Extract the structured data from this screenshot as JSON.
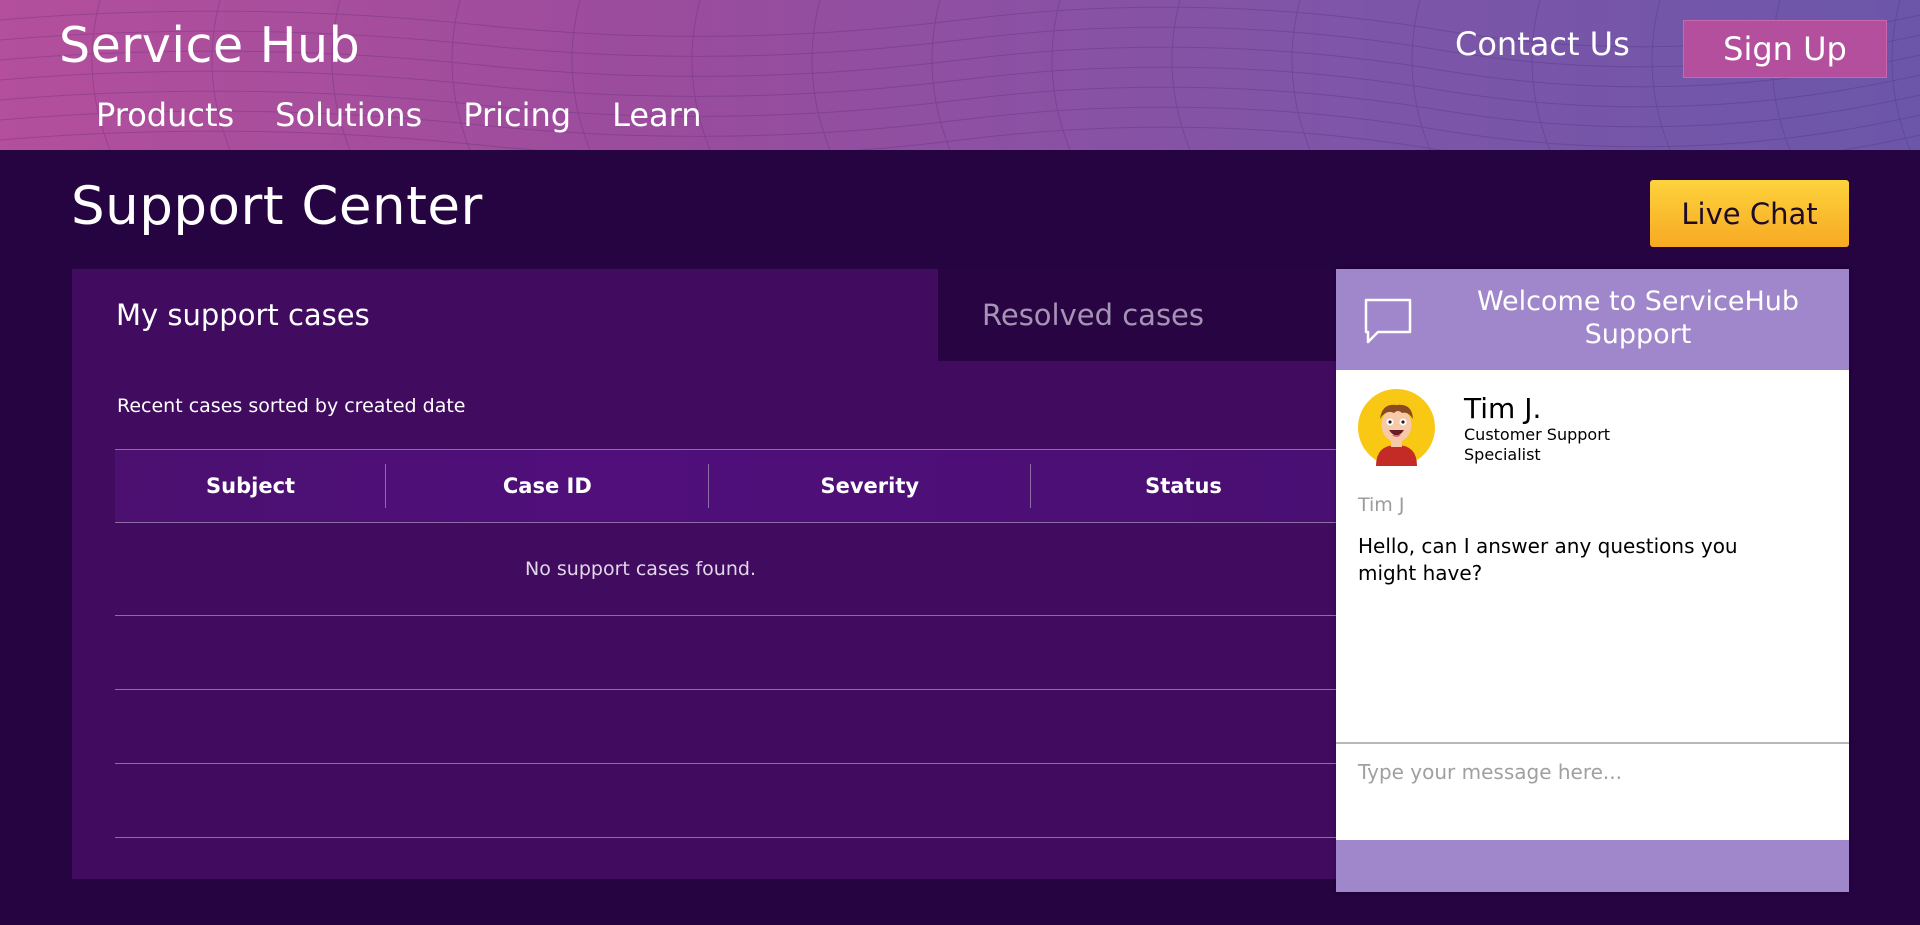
{
  "header": {
    "brand": "Service Hub",
    "nav": [
      "Products",
      "Solutions",
      "Pricing",
      "Learn"
    ],
    "contact_label": "Contact Us",
    "signup_label": "Sign Up"
  },
  "page": {
    "title": "Support Center",
    "live_chat_label": "Live Chat"
  },
  "cases": {
    "tabs": [
      {
        "label": "My support cases",
        "active": true
      },
      {
        "label": "Resolved cases",
        "active": false
      }
    ],
    "subtitle": "Recent cases sorted by created date",
    "columns": [
      "Subject",
      "Case ID",
      "Severity",
      "Status"
    ],
    "empty_message": "No support cases found."
  },
  "chat": {
    "welcome": "Welcome to ServiceHub Support",
    "agent_name": "Tim J.",
    "agent_role": "Customer Support Specialist",
    "message_sender": "Tim J",
    "message_text": "Hello, can I answer any questions you might have?",
    "input_placeholder": "Type your message here..."
  },
  "colors": {
    "header_gradient_start": "#b34f9c",
    "header_gradient_end": "#6c56a9",
    "page_background": "#260341",
    "panel_background": "#410c5f",
    "live_chat_accent": "#fdc22f",
    "chat_header": "#a086cb"
  },
  "icons": {
    "chat_header": "speech-bubble-icon",
    "agent_avatar": "agent-avatar-illustration"
  }
}
